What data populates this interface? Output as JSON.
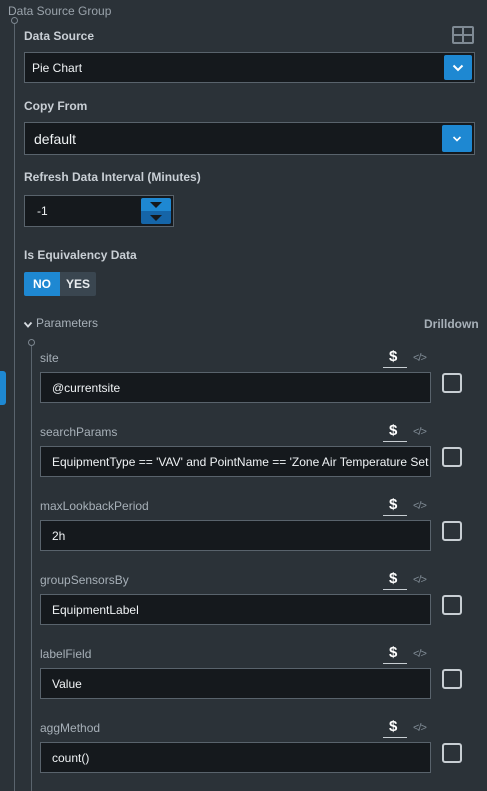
{
  "group_title": "Data Source Group",
  "data_source": {
    "label": "Data Source",
    "value": "Pie Chart"
  },
  "copy_from": {
    "label": "Copy From",
    "value": "default"
  },
  "refresh": {
    "label": "Refresh Data Interval (Minutes)",
    "value": "-1"
  },
  "equivalency": {
    "label": "Is Equivalency Data",
    "no_label": "NO",
    "yes_label": "YES",
    "selected": "NO"
  },
  "parameters": {
    "label": "Parameters",
    "drilldown_label": "Drilldown",
    "dollar_symbol": "$",
    "code_symbol": "</>",
    "items": [
      {
        "name": "site",
        "value": "@currentsite"
      },
      {
        "name": "searchParams",
        "value": "EquipmentType == 'VAV' and PointName == 'Zone Air Temperature Set"
      },
      {
        "name": "maxLookbackPeriod",
        "value": "2h"
      },
      {
        "name": "groupSensorsBy",
        "value": "EquipmentLabel"
      },
      {
        "name": "labelField",
        "value": "Value"
      },
      {
        "name": "aggMethod",
        "value": "count()"
      }
    ]
  },
  "colors": {
    "accent": "#1e88d2",
    "background": "#2b3238",
    "field": "#15191d"
  }
}
